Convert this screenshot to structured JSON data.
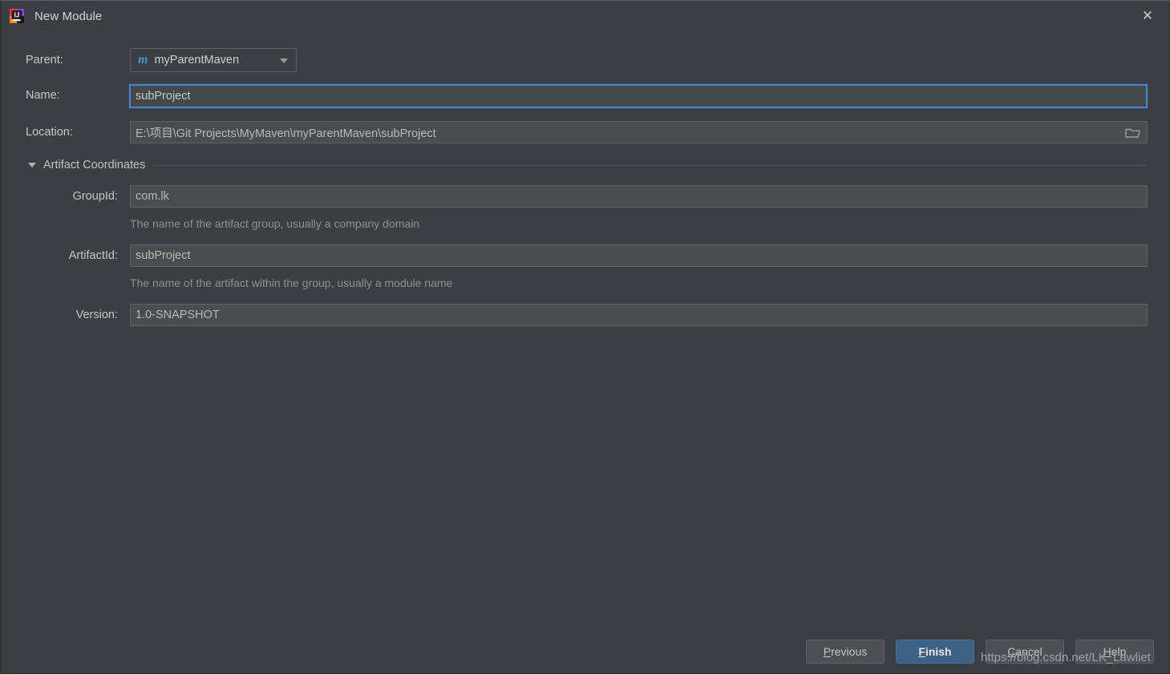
{
  "window": {
    "title": "New Module",
    "app_icon": "intellij-idea-icon",
    "close_label": "✕"
  },
  "form": {
    "parent": {
      "label": "Parent:",
      "value": "myParentMaven",
      "icon": "maven-m-icon",
      "icon_glyph": "m",
      "dropdown_icon": "chevron-down-icon"
    },
    "name": {
      "label": "Name:",
      "value": "subProject",
      "focused": true
    },
    "location": {
      "label": "Location:",
      "value": "E:\\项目\\Git Projects\\MyMaven\\myParentMaven\\subProject",
      "browse_icon": "folder-icon"
    }
  },
  "artifact_section": {
    "title": "Artifact Coordinates",
    "toggle_icon": "triangle-down-icon",
    "expanded": true,
    "fields": [
      {
        "key": "groupid",
        "label": "GroupId:",
        "value": "com.lk",
        "hint": "The name of the artifact group, usually a company domain"
      },
      {
        "key": "artifactid",
        "label": "ArtifactId:",
        "value": "subProject",
        "hint": "The name of the artifact within the group, usually a module name"
      },
      {
        "key": "version",
        "label": "Version:",
        "value": "1.0-SNAPSHOT",
        "hint": ""
      }
    ]
  },
  "buttons": {
    "previous": {
      "mnemonic": "P",
      "rest": "revious"
    },
    "finish": {
      "mnemonic": "F",
      "rest": "inish"
    },
    "cancel": {
      "mnemonic": "C",
      "rest": "ancel"
    },
    "help": {
      "mnemonic": "H",
      "rest": "elp"
    }
  },
  "watermark": {
    "text": "https://blog.csdn.net/LK_Lawliet"
  },
  "colors": {
    "background": "#3c3f41",
    "field_background": "#4a4d4d",
    "focus_border": "#4b87c4",
    "primary_button": "#3d6185",
    "maven_icon": "#3f9bd4",
    "text": "#c7c7c7",
    "hint_text": "#8e9192"
  }
}
